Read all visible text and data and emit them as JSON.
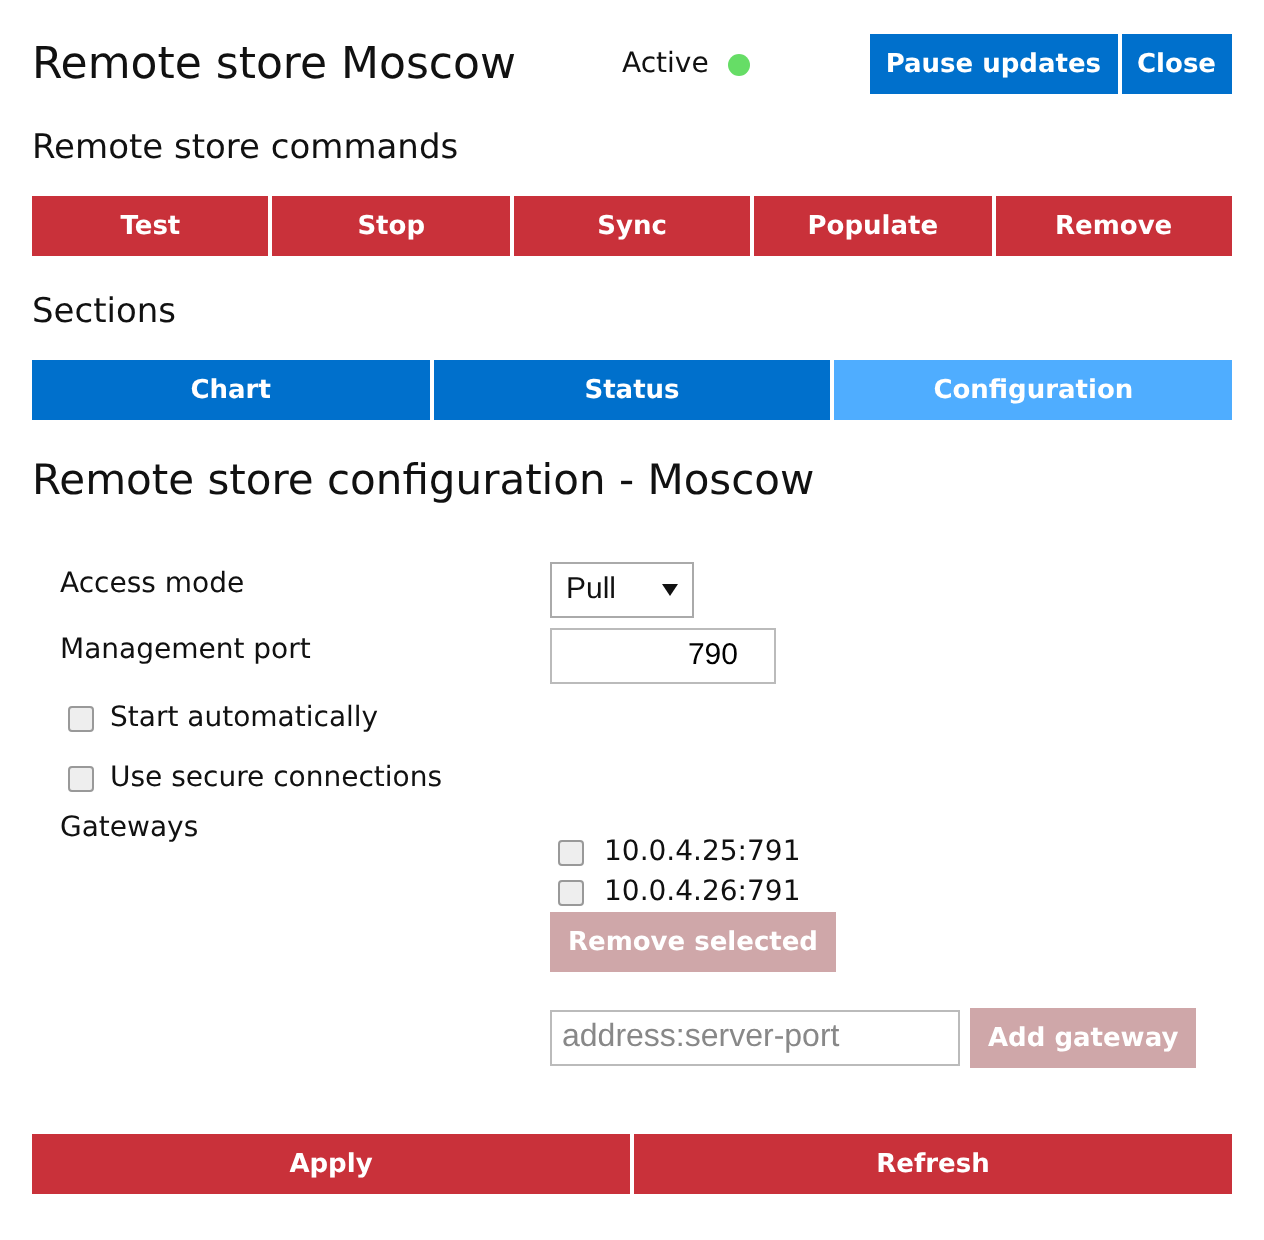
{
  "header": {
    "title": "Remote store Moscow",
    "status": "Active",
    "online": true,
    "buttons": [
      {
        "label": "Pause updates"
      },
      {
        "label": "Close"
      }
    ]
  },
  "commands": {
    "heading": "Remote store commands",
    "buttons": [
      {
        "label": "Test"
      },
      {
        "label": "Stop"
      },
      {
        "label": "Sync"
      },
      {
        "label": "Populate"
      },
      {
        "label": "Remove"
      }
    ]
  },
  "sections": {
    "heading": "Sections",
    "tabs": [
      {
        "label": "Chart",
        "selected": false
      },
      {
        "label": "Status",
        "selected": false
      },
      {
        "label": "Configuration",
        "selected": true
      }
    ]
  },
  "configuration": {
    "heading": "Remote store configuration - Moscow",
    "fields": [
      {
        "kind": "select",
        "label": "Access mode",
        "value": "Pull"
      },
      {
        "kind": "number",
        "label": "Management port",
        "value": "790"
      },
      {
        "kind": "checkbox",
        "label": "Start automatically",
        "checked": false
      },
      {
        "kind": "checkbox",
        "label": "Use secure connections",
        "checked": false
      }
    ],
    "gateways": {
      "label": "Gateways",
      "items": [
        {
          "address": "10.0.4.25:791",
          "checked": false
        },
        {
          "address": "10.0.4.26:791",
          "checked": false
        }
      ],
      "remove_button": {
        "label": "Remove selected",
        "disabled": true
      },
      "new_gateway": {
        "placeholder": "address:server-port"
      },
      "add_button": {
        "label": "Add gateway",
        "disabled": true
      }
    }
  },
  "footer": {
    "buttons": [
      {
        "label": "Apply"
      },
      {
        "label": "Refresh"
      }
    ]
  }
}
